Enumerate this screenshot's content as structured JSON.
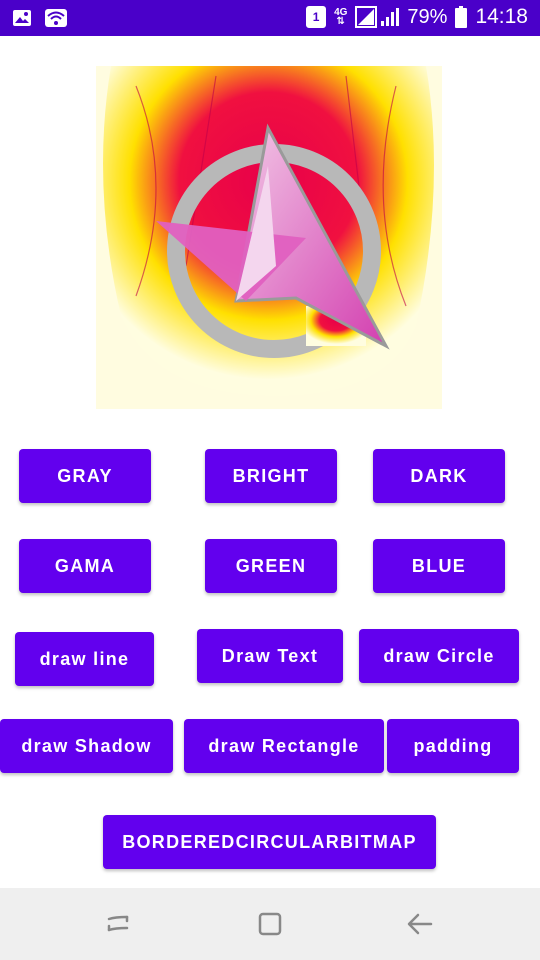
{
  "status_bar": {
    "sim_label": "1",
    "network_label": "4G",
    "battery_percent": "79%",
    "time": "14:18",
    "icons": [
      "image-icon",
      "wifi-icon",
      "sim-icon",
      "network-icon",
      "signal-icon",
      "battery-icon"
    ]
  },
  "hero_image": {
    "description_icon": "artist-logo-image"
  },
  "buttons": {
    "gray": "GRAY",
    "bright": "BRIGHT",
    "dark": "DARK",
    "gama": "GAMA",
    "green": "GREEN",
    "blue": "BLUE",
    "draw_line": "draw line",
    "draw_text": "Draw Text",
    "draw_circle": "draw Circle",
    "draw_shadow": "draw Shadow",
    "draw_rectangle": "draw Rectangle",
    "padding": "padding",
    "bordered_circular_bitmap": "BORDEREDCIRCULARBITMAP"
  },
  "colors": {
    "status_bar": "#4a00c9",
    "button": "#6200ee",
    "nav_bar": "#efefef"
  },
  "nav_bar": {
    "icons": [
      "recents-icon",
      "home-icon",
      "back-icon"
    ]
  }
}
